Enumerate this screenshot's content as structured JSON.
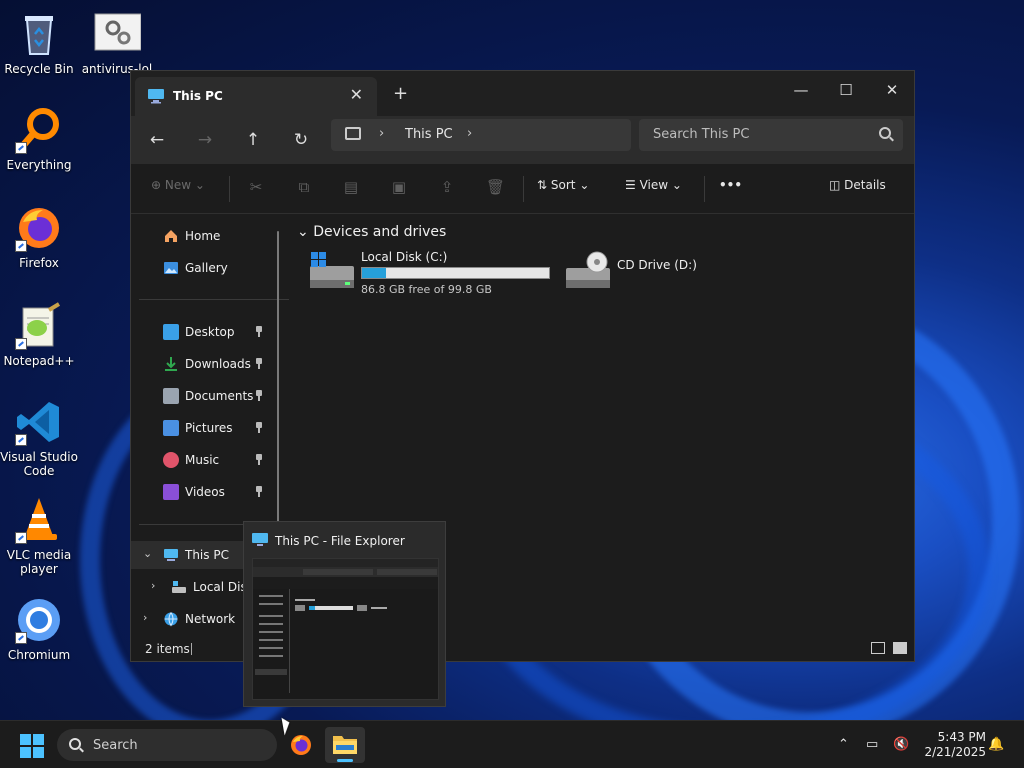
{
  "desktop": {
    "icons": [
      {
        "label": "Recycle Bin",
        "icon": "recycle-bin-icon"
      },
      {
        "label": "antivirus-lol",
        "icon": "settings-file-icon"
      },
      {
        "label": "Everything",
        "icon": "everything-search-icon"
      },
      {
        "label": "Firefox",
        "icon": "firefox-icon"
      },
      {
        "label": "Notepad++",
        "icon": "notepadpp-icon"
      },
      {
        "label": "Visual Studio Code",
        "icon": "vscode-icon"
      },
      {
        "label": "VLC media player",
        "icon": "vlc-icon"
      },
      {
        "label": "Chromium",
        "icon": "chromium-icon"
      }
    ]
  },
  "explorer": {
    "tab_title": "This PC",
    "tab_close": "✕",
    "new_tab": "+",
    "window_controls": {
      "minimize": "—",
      "maximize": "☐",
      "close": "✕"
    },
    "nav": {
      "back": "←",
      "forward": "→",
      "up": "↑",
      "refresh": "↻"
    },
    "address": {
      "location": "This PC",
      "chevron": "›"
    },
    "search": {
      "placeholder": "Search This PC"
    },
    "toolbar": {
      "new_label": "New",
      "sort_label": "Sort",
      "view_label": "View",
      "more_label": "•••",
      "details_label": "Details",
      "dropdown_chevron": "⌄"
    },
    "sidebar": {
      "home": "Home",
      "gallery": "Gallery",
      "quick_access": [
        {
          "label": "Desktop",
          "color": "#3aa0e8"
        },
        {
          "label": "Downloads",
          "color": "#2fa84f"
        },
        {
          "label": "Documents",
          "color": "#9aa4b0"
        },
        {
          "label": "Pictures",
          "color": "#4a90e2"
        },
        {
          "label": "Music",
          "color": "#e0546a"
        },
        {
          "label": "Videos",
          "color": "#8a4fd8"
        }
      ],
      "this_pc": "This PC",
      "local_disk": "Local Disk",
      "network": "Network",
      "expand_open": "⌄",
      "expand_closed": "›"
    },
    "content": {
      "group_header": "Devices and drives",
      "group_chevron": "⌄",
      "drives": [
        {
          "name": "Local Disk (C:)",
          "free_text": "86.8 GB free of 99.8 GB",
          "used_fraction": 0.13
        },
        {
          "name": "CD Drive (D:)"
        }
      ]
    },
    "status": {
      "item_count": "2 items"
    }
  },
  "preview": {
    "title": "This PC - File Explorer"
  },
  "taskbar": {
    "search_placeholder": "Search",
    "tray_chevron": "⌃",
    "time": "5:43 PM",
    "date": "2/21/2025"
  },
  "colors": {
    "accent": "#4cc2ff",
    "bar_fill": "#26a0da"
  }
}
